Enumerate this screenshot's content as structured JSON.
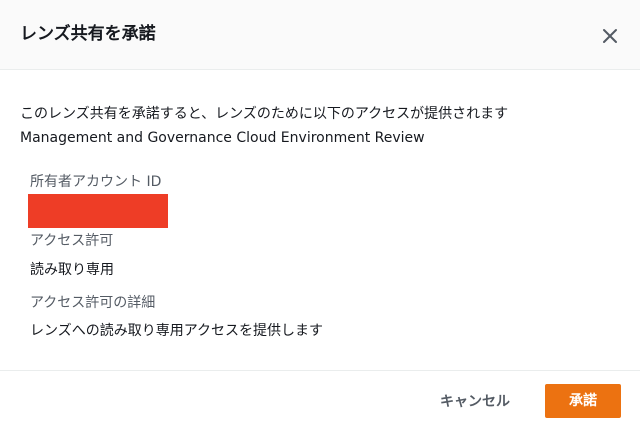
{
  "modal": {
    "title": "レンズ共有を承諾",
    "close_icon": "close-icon"
  },
  "body": {
    "intro": "このレンズ共有を承諾すると、レンズのために以下のアクセスが提供されます",
    "lens_name": "Management and Governance Cloud Environment Review",
    "fields": {
      "owner_label": "所有者アカウント ID",
      "access_label": "アクセス許可",
      "access_value": "読み取り専用",
      "detail_label": "アクセス許可の詳細",
      "detail_value": "レンズへの読み取り専用アクセスを提供します"
    },
    "redaction_color": "#ee3d26"
  },
  "footer": {
    "cancel_label": "キャンセル",
    "accept_label": "承諾",
    "accent_color": "#ec7211"
  }
}
